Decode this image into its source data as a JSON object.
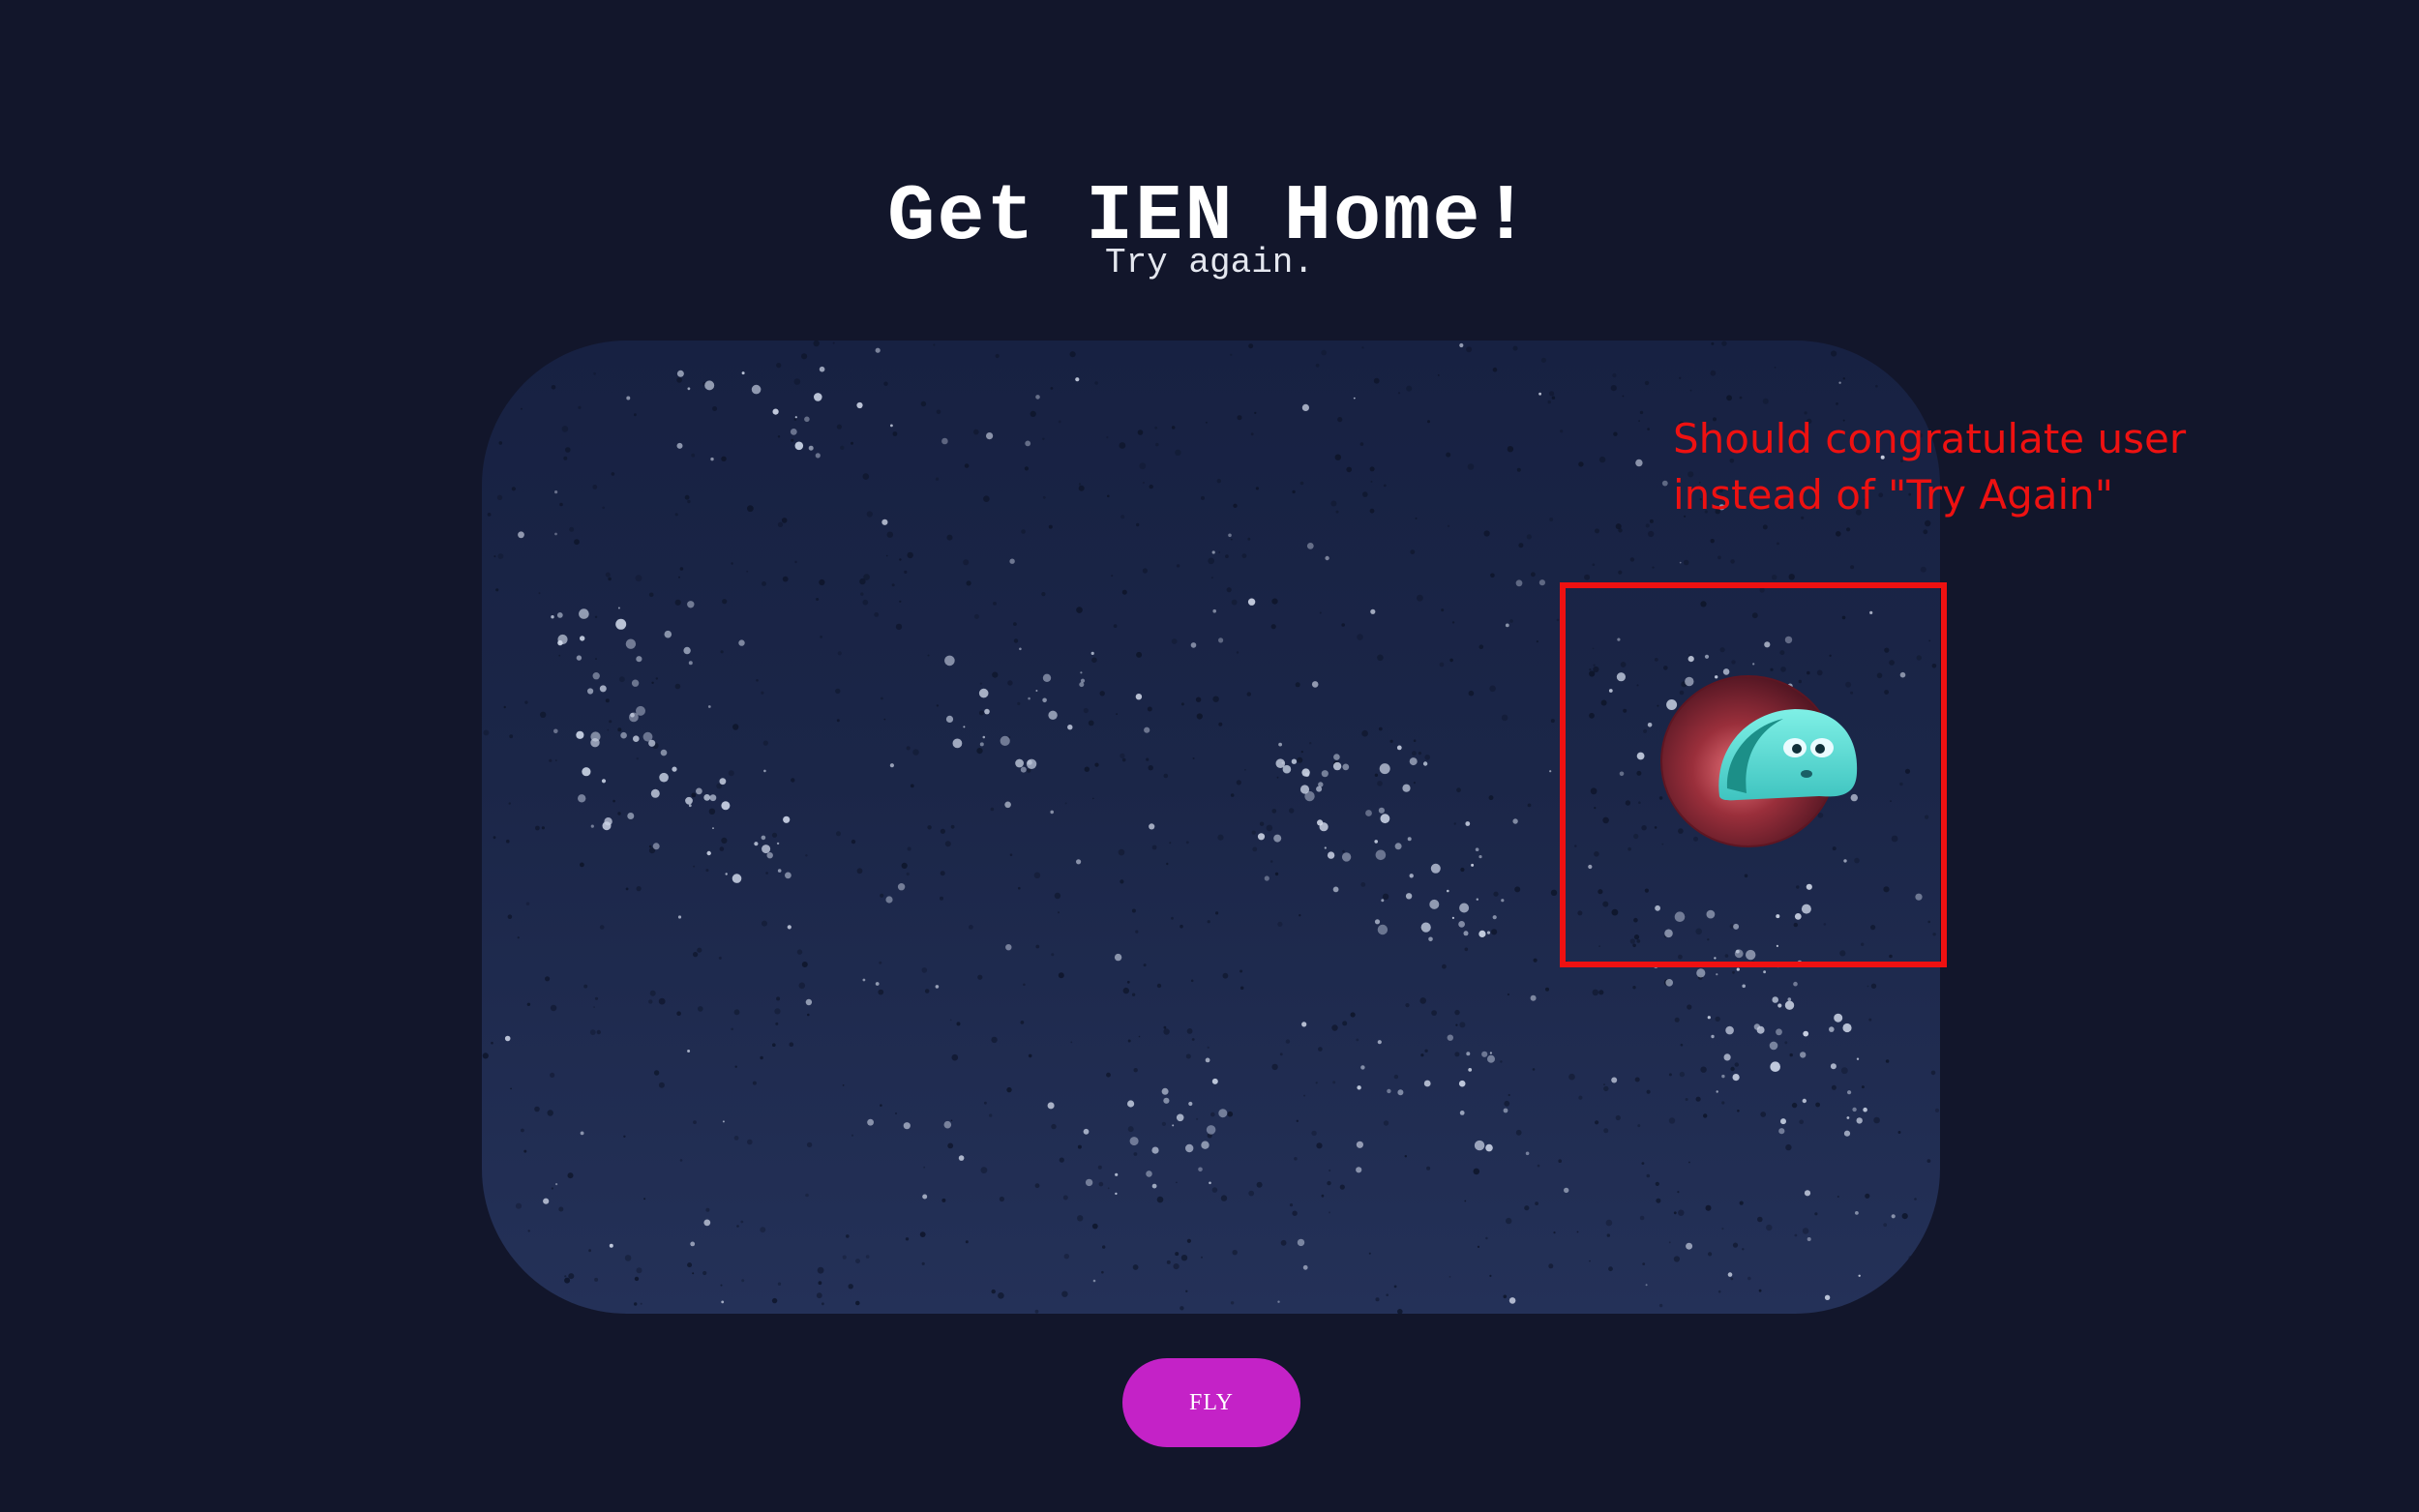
{
  "header": {
    "title": "Get IEN Home!",
    "status": "Try again."
  },
  "game": {
    "player_icon": "alien-in-red-planet-icon",
    "background": "starfield"
  },
  "annotation": {
    "note": "Should congratulate user\ninstead of \"Try Again\"",
    "color": "#ee1111"
  },
  "controls": {
    "fly_label": "FLY",
    "fly_color": "#c422c7"
  },
  "colors": {
    "page_background": "#12162b",
    "space_top": "#172142",
    "space_bottom": "#243158"
  }
}
